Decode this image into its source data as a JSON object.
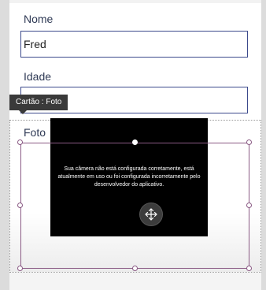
{
  "form": {
    "nome": {
      "label": "Nome",
      "value": "Fred"
    },
    "idade": {
      "label": "Idade",
      "value": ""
    },
    "foto": {
      "label": "Foto"
    }
  },
  "tooltip": {
    "text": "Cartão : Foto"
  },
  "camera": {
    "message": "Sua câmera não está configurada corretamente, está atualmente em uso ou foi configurada incorretamente pelo desenvolvedor do aplicativo.",
    "move_icon": "move-arrows-icon"
  },
  "colors": {
    "input_border": "#3c4a8c",
    "selection_border": "#8a5a84",
    "tooltip_bg": "#3a3a3a",
    "camera_bg": "#000000"
  }
}
